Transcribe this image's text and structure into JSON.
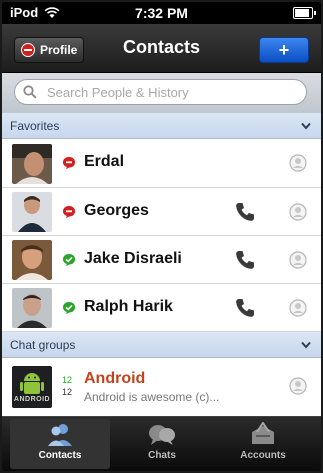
{
  "status": {
    "carrier": "iPod",
    "time": "7:32 PM"
  },
  "navbar": {
    "title": "Contacts",
    "profile_label": "Profile",
    "add_label": "+"
  },
  "search": {
    "placeholder": "Search People & History"
  },
  "sections": {
    "favorites": {
      "title": "Favorites"
    },
    "chat_groups": {
      "title": "Chat groups"
    }
  },
  "contacts": [
    {
      "name": "Erdal",
      "status": "busy",
      "has_phone": false
    },
    {
      "name": "Georges",
      "status": "busy",
      "has_phone": true
    },
    {
      "name": "Jake Disraeli",
      "status": "online",
      "has_phone": true
    },
    {
      "name": "Ralph Harik",
      "status": "online",
      "has_phone": true
    }
  ],
  "chat_group": {
    "name": "Android",
    "avatar_text": "ANDROID",
    "count_top": "12",
    "count_bottom": "12",
    "preview": "Android is awesome (c)..."
  },
  "tabs": [
    {
      "label": "Contacts",
      "icon": "contacts-icon",
      "active": true
    },
    {
      "label": "Chats",
      "icon": "chats-icon",
      "active": false
    },
    {
      "label": "Accounts",
      "icon": "accounts-icon",
      "active": false
    }
  ],
  "colors": {
    "accent_blue": "#0b4fc4",
    "busy_red": "#d21f1f",
    "online_green": "#2aa52a",
    "group_name": "#c0441c"
  }
}
